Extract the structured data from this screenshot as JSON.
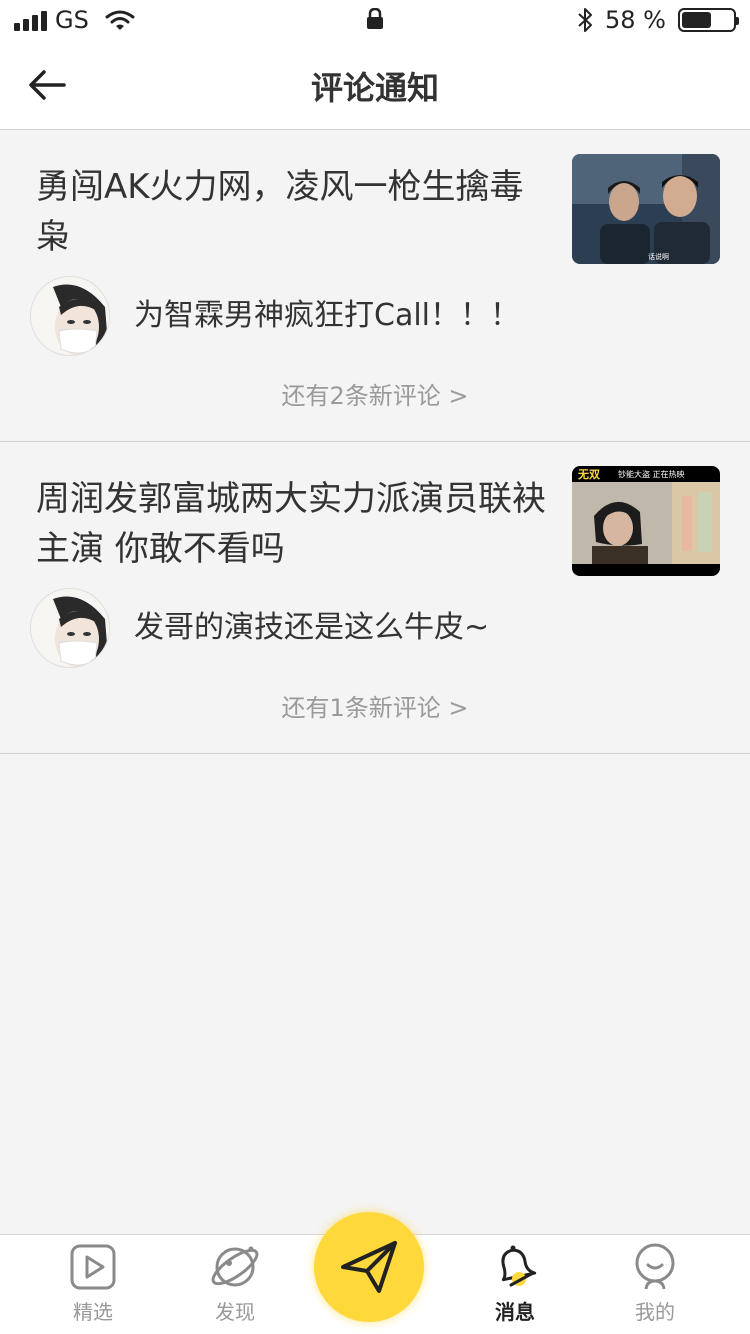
{
  "status_bar": {
    "carrier": "GS",
    "battery_text": "58 %",
    "battery_level": 0.58
  },
  "nav": {
    "title": "评论通知"
  },
  "notifications": [
    {
      "title": "勇闯AK火力网，凌风一枪生擒毒枭",
      "comment": "为智霖男神疯狂打Call！！！",
      "more": "还有2条新评论 >",
      "thumb_caption": "话说啊"
    },
    {
      "title": "周润发郭富城两大实力派演员联袂主演  你敢不看吗",
      "comment": "发哥的演技还是这么牛皮~",
      "more": "还有1条新评论 >",
      "thumb_caption": "钞能大盗 正在热映",
      "thumb_logo": "无双"
    }
  ],
  "tabs": [
    {
      "label": "精选",
      "icon": "play-icon"
    },
    {
      "label": "发现",
      "icon": "planet-icon"
    },
    {
      "label": "消息",
      "icon": "bell-icon",
      "active": true
    },
    {
      "label": "我的",
      "icon": "user-icon"
    }
  ],
  "fab_icon": "send-icon",
  "colors": {
    "accent": "#ffd93b",
    "background": "#f4f4f4",
    "muted_text": "#9a9a9a"
  }
}
